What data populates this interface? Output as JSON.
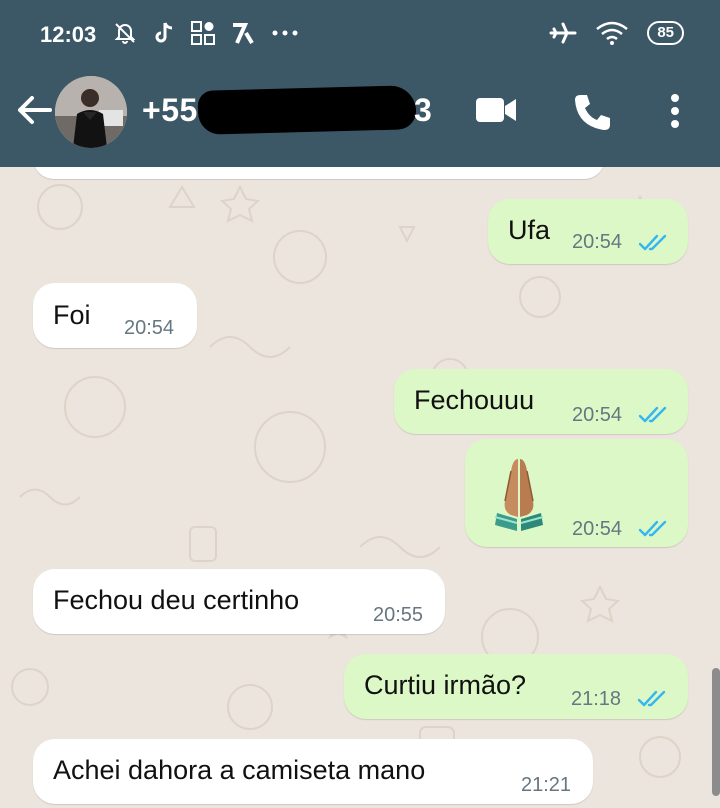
{
  "status_bar": {
    "time": "12:03",
    "battery": "85"
  },
  "app_bar": {
    "contact_prefix": "+55",
    "contact_suffix": "3"
  },
  "colors": {
    "header": "#3c5866",
    "chat_background": "#ece5dd",
    "incoming_bubble": "#ffffff",
    "outgoing_bubble": "#dcf8c6",
    "read_ticks": "#34b7f1"
  },
  "messages": [
    {
      "direction": "out",
      "text": "Ufa",
      "time": "20:54",
      "read": true
    },
    {
      "direction": "in",
      "text": "Foi",
      "time": "20:54"
    },
    {
      "direction": "out",
      "text": "Fechouuu",
      "time": "20:54",
      "read": true
    },
    {
      "direction": "out",
      "emoji": "folded-hands",
      "time": "20:54",
      "read": true
    },
    {
      "direction": "in",
      "text": "Fechou deu certinho",
      "time": "20:55"
    },
    {
      "direction": "out",
      "text": "Curtiu irmão?",
      "time": "21:18",
      "read": true
    },
    {
      "direction": "in",
      "text": "Achei dahora a camiseta mano",
      "time": "21:21"
    }
  ]
}
